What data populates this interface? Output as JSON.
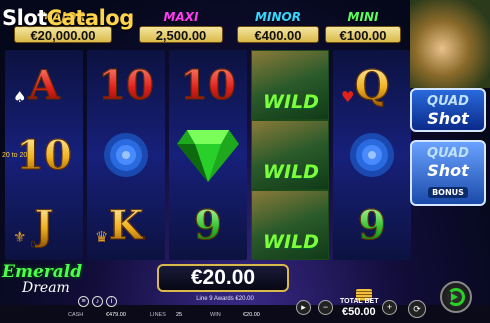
{
  "watermark": {
    "part1": "Slot",
    "part2": "Catalog"
  },
  "jackpots": {
    "major": {
      "label": "MAJOR",
      "value": "€20,000.00"
    },
    "maxi": {
      "label": "MAXI",
      "value": "2,500.00"
    },
    "minor": {
      "label": "MINOR",
      "value": "€400.00"
    },
    "mini": {
      "label": "MINI",
      "value": "€100.00"
    }
  },
  "reels": [
    [
      {
        "text": "A",
        "style": "red",
        "suit": "♠"
      },
      {
        "text": "10",
        "style": "gold"
      },
      {
        "text": "J",
        "style": "gold",
        "suit": "⚜"
      }
    ],
    [
      {
        "text": "10",
        "style": "red"
      },
      {
        "text": "rose",
        "style": "blue"
      },
      {
        "text": "K",
        "style": "gold",
        "suit": "♛"
      }
    ],
    [
      {
        "text": "10",
        "style": "red"
      },
      {
        "text": "diamond",
        "style": "green"
      },
      {
        "text": "9",
        "style": "green"
      }
    ],
    [
      {
        "text": "WILD",
        "style": "wild"
      },
      {
        "text": "WILD",
        "style": "wild"
      },
      {
        "text": "WILD",
        "style": "wild"
      }
    ],
    [
      {
        "text": "Q",
        "style": "gold",
        "suit": "♥"
      },
      {
        "text": "rose",
        "style": "blue"
      },
      {
        "text": "9",
        "style": "green"
      }
    ]
  ],
  "side_tag": "20 to 20",
  "side_buttons": {
    "quad_shot": {
      "line1": "QUAD",
      "line2": "Shot"
    },
    "quad_shot_bonus": {
      "line1": "QUAD",
      "line2": "Shot",
      "line3": "BONUS"
    }
  },
  "logo": {
    "line1": "Emerald",
    "line2": "Dream"
  },
  "win": {
    "amount": "€20.00",
    "line_text": "Line 9 Awards €20.00"
  },
  "meta": {
    "cash_label": "CASH",
    "cash_value": "€479.00",
    "lines_label": "LINES",
    "lines_value": "25",
    "win_label": "WIN",
    "win_value": "€20.00"
  },
  "total_bet": {
    "label": "TOTAL BET",
    "value": "€50.00"
  },
  "colors": {
    "wild_green": "#7cff3a",
    "gold": "#d9b94a",
    "spin_green": "#2ad02a"
  }
}
